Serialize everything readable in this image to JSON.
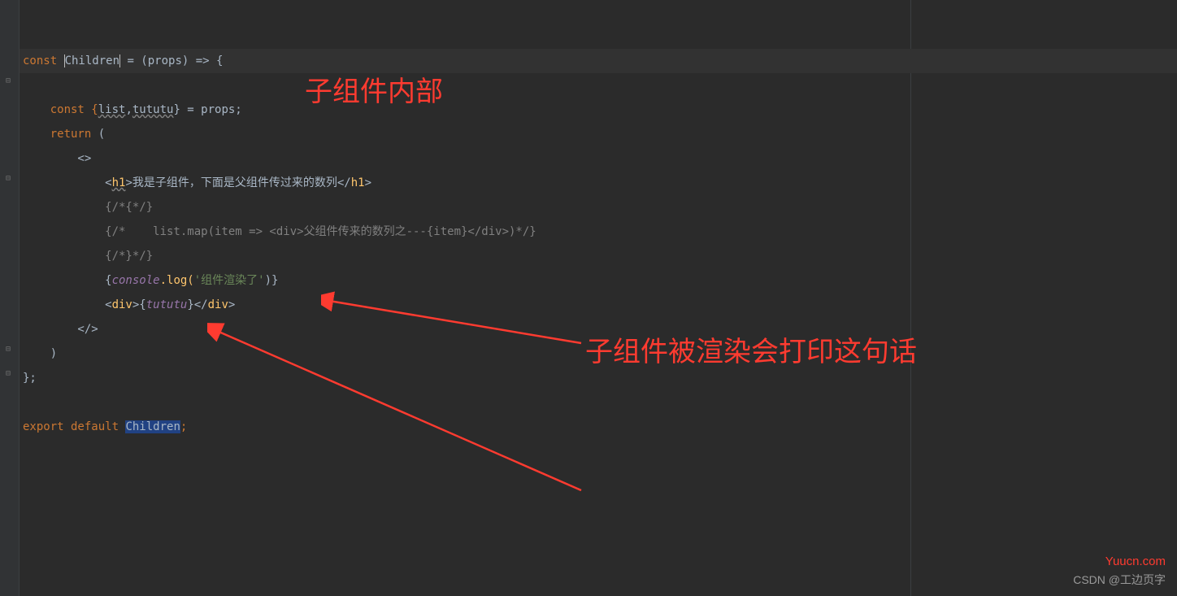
{
  "code": {
    "l1": "",
    "l2": "",
    "l3_pre": "const ",
    "l3_children": "Children",
    "l3_post": " = (props) => {",
    "l4": "",
    "l5_pre": "    const {",
    "l5_list": "list",
    "l5_comma": ",",
    "l5_tututu": "tututu",
    "l5_post": "} = props;",
    "l6_return": "    return ",
    "l6_paren": "(",
    "l7": "        <>",
    "l8_pre": "            <",
    "l8_h1": "h1",
    "l8_mid": ">我是子组件，下面是父组件传过来的数列</",
    "l8_h1b": "h1",
    "l8_post": ">",
    "l9": "            {/*{*/}",
    "l10": "            {/*    list.map(item => <div>父组件传来的数列之---{item}</div>)*/}",
    "l11": "            {/*}*/}",
    "l12_pre": "            {",
    "l12_console": "console",
    "l12_log": ".log(",
    "l12_str": "'组件渲染了'",
    "l12_post": ")}",
    "l13_pre": "            <",
    "l13_div": "div",
    "l13_mid": ">{",
    "l13_tututu": "tututu",
    "l13_mid2": "}</",
    "l13_divb": "div",
    "l13_post": ">",
    "l14": "        </>",
    "l15": "    )",
    "l16": "};",
    "l17": "",
    "l18_export": "export default ",
    "l18_children": "Children",
    "l18_post": ";"
  },
  "annotations": {
    "title": "子组件内部",
    "note": "子组件被渲染会打印这句话"
  },
  "watermarks": {
    "w1": "Yuucn.com",
    "w2": "CSDN @工边页字"
  }
}
